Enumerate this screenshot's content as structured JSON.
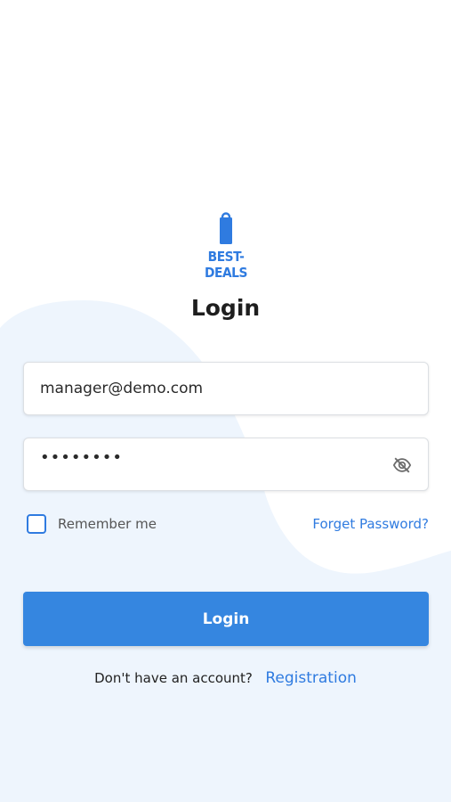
{
  "brand": {
    "logo_text": "BEST-DEALS"
  },
  "title": "Login",
  "form": {
    "email_value": "manager@demo.com",
    "password_value": "••••••••",
    "remember_label": "Remember me",
    "forgot_label": "Forget Password?",
    "submit_label": "Login"
  },
  "footer": {
    "prompt": "Don't have an account?",
    "link": "Registration"
  },
  "icons": {
    "password_toggle": "eye-off-icon",
    "logo": "shopping-bag-icon"
  },
  "colors": {
    "accent": "#3586e0",
    "link": "#2f7be0",
    "background_shape": "#eef5fd"
  }
}
